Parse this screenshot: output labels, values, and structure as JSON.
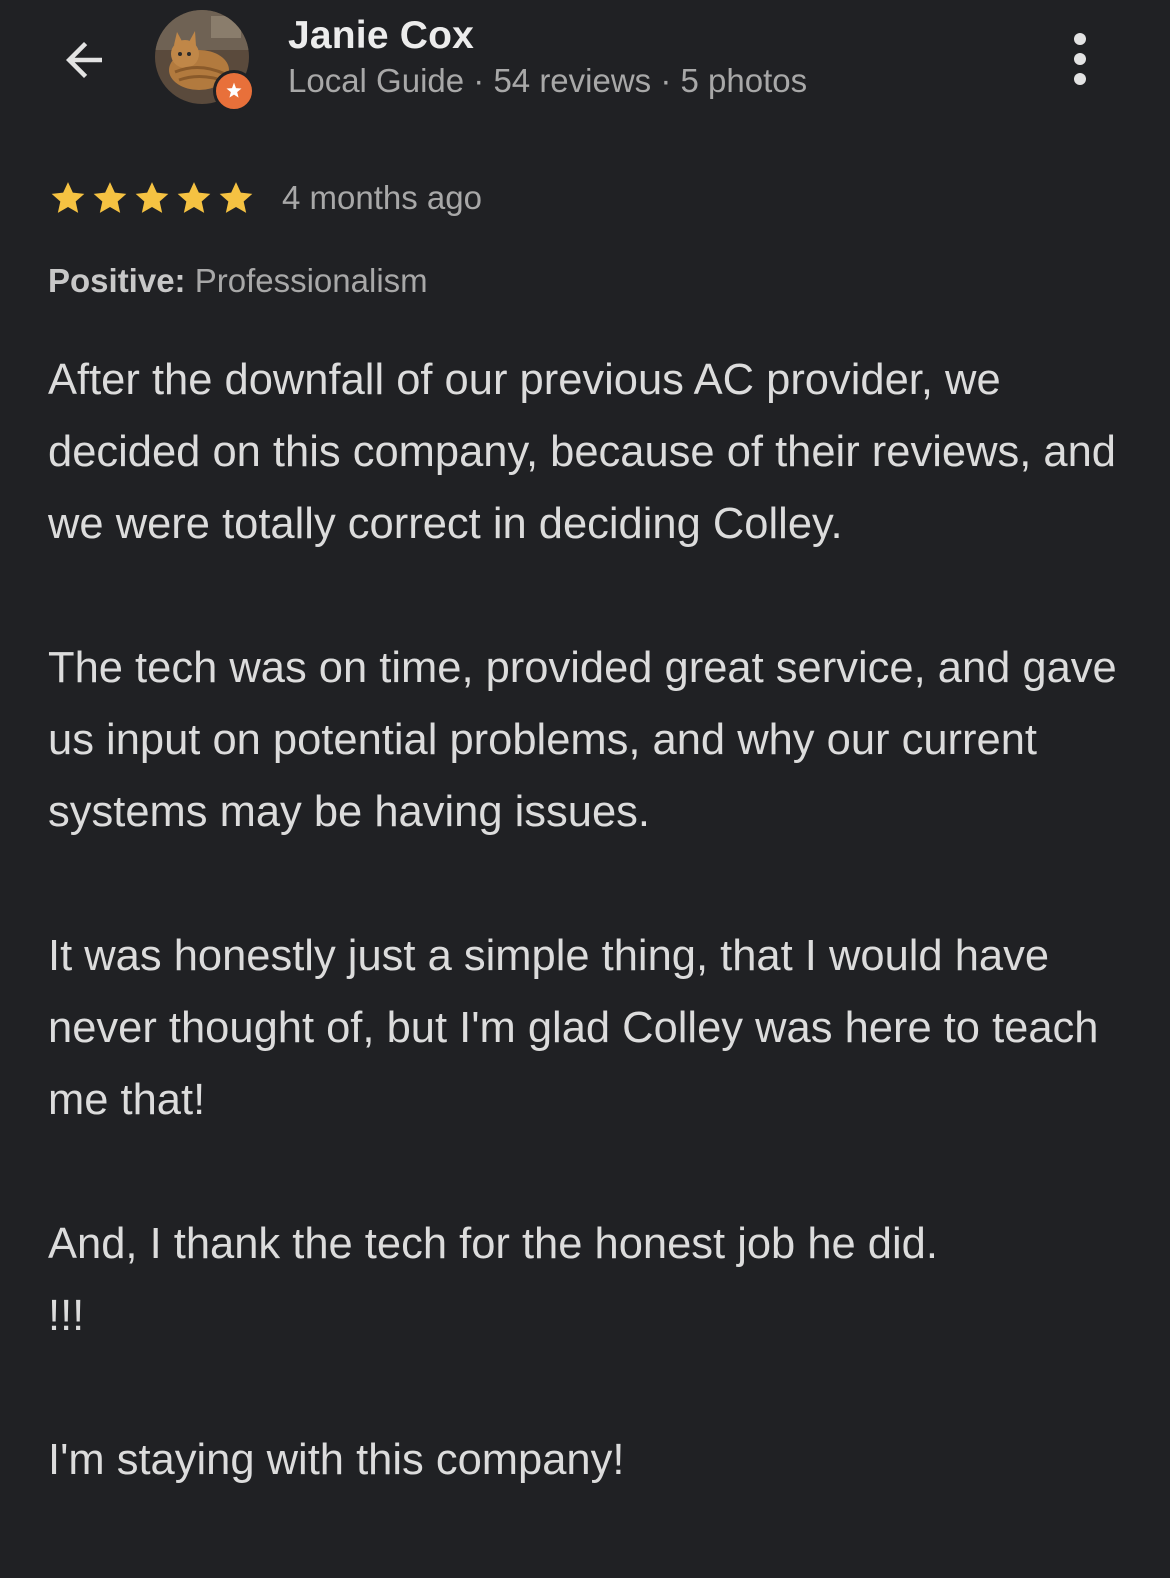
{
  "header": {
    "reviewer_name": "Janie Cox",
    "reviewer_meta": "Local Guide · 54 reviews · 5 photos",
    "back_icon": "arrow-back-icon",
    "more_icon": "more-vert-icon",
    "badge_icon": "local-guide-star-icon"
  },
  "review": {
    "rating": 5,
    "rating_max": 5,
    "time": "4 months ago",
    "attribute_label": "Positive:",
    "attribute_value": "Professionalism",
    "paragraphs": [
      "After the downfall of our previous AC provider, we decided on this company, because of their reviews, and we were totally correct in deciding Colley.",
      "The tech was on time, provided great service, and gave us input on potential problems, and why our current systems may be having issues.",
      "It was honestly just a simple thing, that I would have never thought of, but I'm glad Colley was here to teach me that!",
      "And, I thank the tech for the honest job he did.",
      "!!!",
      "I'm staying with this company!"
    ]
  },
  "colors": {
    "background": "#202124",
    "star": "#f5c242",
    "badge": "#e8703a",
    "text_primary": "#ececec",
    "text_secondary": "#a8a8a8"
  }
}
